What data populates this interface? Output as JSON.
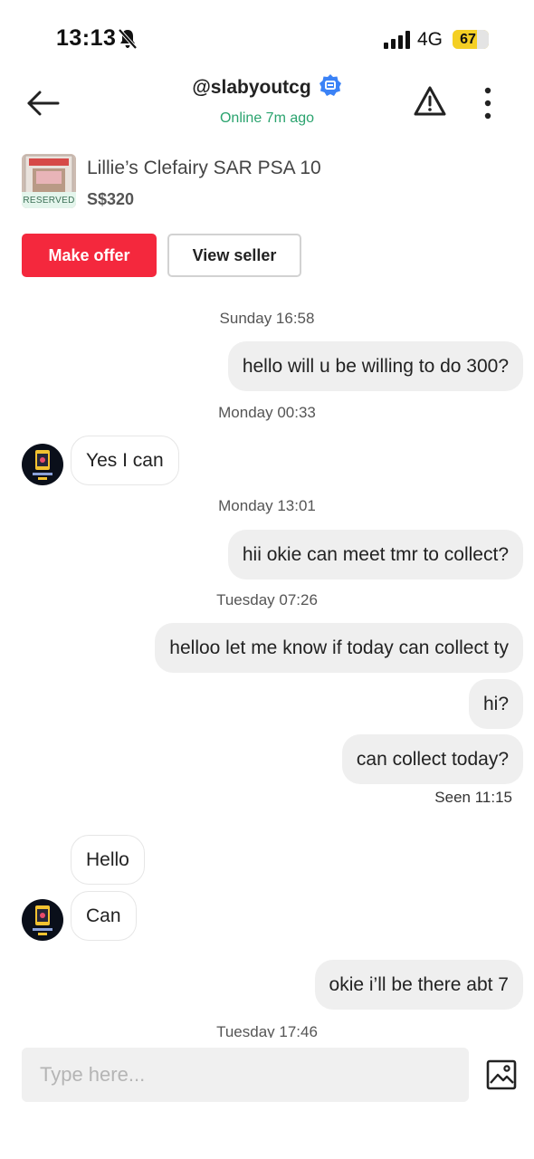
{
  "status_bar": {
    "time": "13:13",
    "network": "4G",
    "battery": "67",
    "battery_level": 0.67
  },
  "header": {
    "username": "@slabyoutcg",
    "status": "Online 7m ago"
  },
  "listing": {
    "title": "Lillie’s Clefairy SAR PSA 10",
    "price": "S$320",
    "tag": "RESERVED"
  },
  "actions": {
    "offer_label": "Make offer",
    "seller_label": "View seller"
  },
  "chat": {
    "t1": "Sunday 16:58",
    "m1": "hello will u be willing to do 300?",
    "t2": "Monday 00:33",
    "m2": "Yes I can",
    "t3": "Monday 13:01",
    "m3": "hii okie can meet tmr to collect?",
    "t4": "Tuesday 07:26",
    "m4": "helloo let me know if today can collect ty",
    "m5": "hi?",
    "m6": "can collect today?",
    "seen": "Seen 11:15",
    "m7": "Hello",
    "m8": "Can",
    "m9": "okie i’ll be there abt 7",
    "t5": "Tuesday 17:46"
  },
  "composer": {
    "placeholder": "Type here..."
  },
  "colors": {
    "accent": "#f4283d",
    "online": "#2aa36e",
    "verified": "#3b82f6",
    "bubble_out": "#efefef"
  }
}
